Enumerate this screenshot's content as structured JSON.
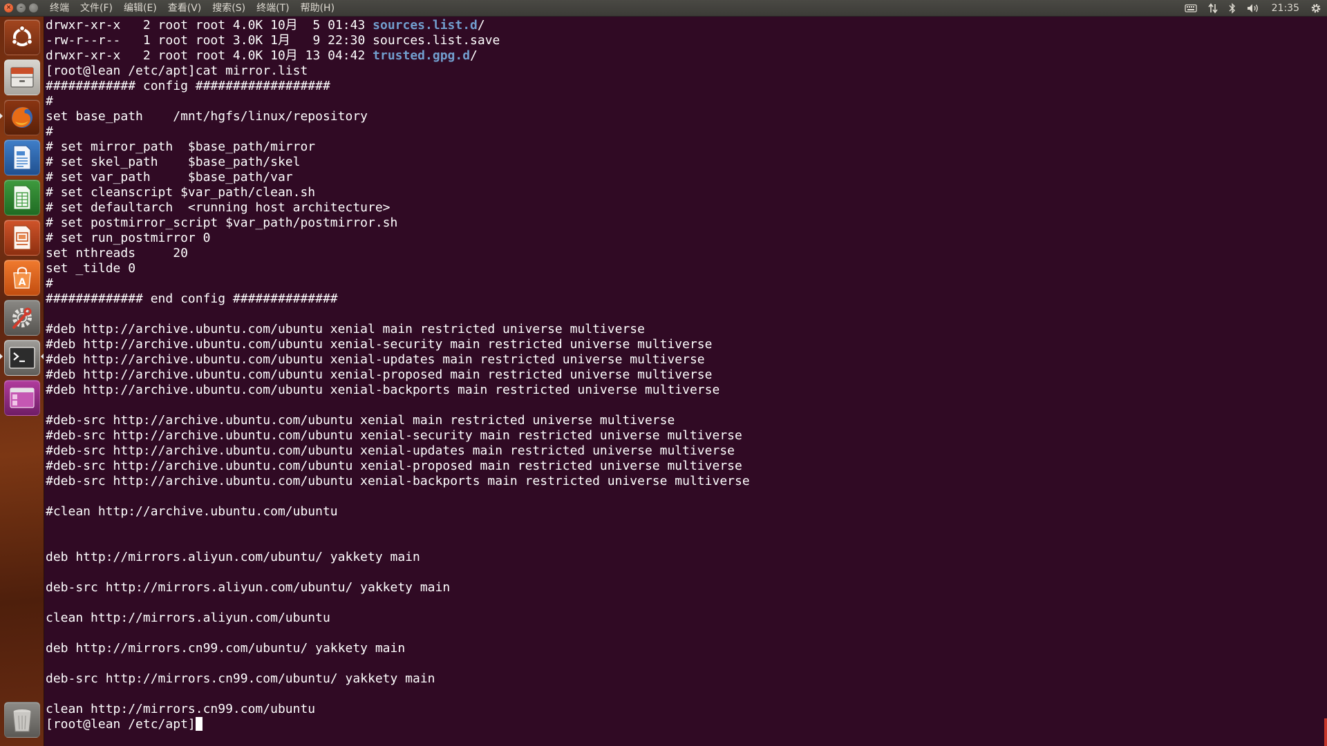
{
  "window": {
    "buttons": [
      {
        "name": "close-button",
        "glyph": "×"
      },
      {
        "name": "minimize-button",
        "glyph": "–"
      },
      {
        "name": "maximize-button",
        "glyph": ""
      }
    ]
  },
  "menubar": {
    "items": [
      "终端",
      "文件(F)",
      "编辑(E)",
      "查看(V)",
      "搜索(S)",
      "终端(T)",
      "帮助(H)"
    ]
  },
  "indicators": {
    "keyboard_icon": "keyboard-icon",
    "network_icon": "network-icon",
    "bluetooth_icon": "bluetooth-icon",
    "sound_icon": "volume-icon",
    "clock": "21:35",
    "settings_icon": "gear-icon"
  },
  "launcher": {
    "items": [
      {
        "name": "dash-home",
        "icon": "ubuntu-logo-icon"
      },
      {
        "name": "files",
        "icon": "file-cabinet-icon"
      },
      {
        "name": "firefox",
        "icon": "firefox-icon"
      },
      {
        "name": "writer",
        "icon": "document-icon"
      },
      {
        "name": "calc",
        "icon": "spreadsheet-icon"
      },
      {
        "name": "impress",
        "icon": "presentation-icon"
      },
      {
        "name": "software-center",
        "icon": "shopping-bag-icon"
      },
      {
        "name": "system-settings",
        "icon": "wrench-gear-icon"
      },
      {
        "name": "terminal",
        "icon": "terminal-icon"
      },
      {
        "name": "workspace-switcher",
        "icon": "workspaces-icon"
      },
      {
        "name": "trash",
        "icon": "trash-icon"
      }
    ]
  },
  "colors": {
    "terminal_bg": "#300a24",
    "terminal_fg": "#ffffff",
    "directory": "#729fcf"
  },
  "terminal": {
    "lines": [
      {
        "text": "drwxr-xr-x   2 root root 4.0K 10月  5 01:43 ",
        "dir": "sources.list.d",
        "suffix": "/"
      },
      {
        "text": "-rw-r--r--   1 root root 3.0K 1月   9 22:30 sources.list.save"
      },
      {
        "text": "drwxr-xr-x   2 root root 4.0K 10月 13 04:42 ",
        "dir": "trusted.gpg.d",
        "suffix": "/"
      },
      {
        "text": "[root@lean /etc/apt]cat mirror.list"
      },
      {
        "text": "############ config ##################"
      },
      {
        "text": "#"
      },
      {
        "text": "set base_path    /mnt/hgfs/linux/repository"
      },
      {
        "text": "#"
      },
      {
        "text": "# set mirror_path  $base_path/mirror"
      },
      {
        "text": "# set skel_path    $base_path/skel"
      },
      {
        "text": "# set var_path     $base_path/var"
      },
      {
        "text": "# set cleanscript $var_path/clean.sh"
      },
      {
        "text": "# set defaultarch  <running host architecture>"
      },
      {
        "text": "# set postmirror_script $var_path/postmirror.sh"
      },
      {
        "text": "# set run_postmirror 0"
      },
      {
        "text": "set nthreads     20"
      },
      {
        "text": "set _tilde 0"
      },
      {
        "text": "#"
      },
      {
        "text": "############# end config ##############"
      },
      {
        "text": ""
      },
      {
        "text": "#deb http://archive.ubuntu.com/ubuntu xenial main restricted universe multiverse"
      },
      {
        "text": "#deb http://archive.ubuntu.com/ubuntu xenial-security main restricted universe multiverse"
      },
      {
        "text": "#deb http://archive.ubuntu.com/ubuntu xenial-updates main restricted universe multiverse"
      },
      {
        "text": "#deb http://archive.ubuntu.com/ubuntu xenial-proposed main restricted universe multiverse"
      },
      {
        "text": "#deb http://archive.ubuntu.com/ubuntu xenial-backports main restricted universe multiverse"
      },
      {
        "text": ""
      },
      {
        "text": "#deb-src http://archive.ubuntu.com/ubuntu xenial main restricted universe multiverse"
      },
      {
        "text": "#deb-src http://archive.ubuntu.com/ubuntu xenial-security main restricted universe multiverse"
      },
      {
        "text": "#deb-src http://archive.ubuntu.com/ubuntu xenial-updates main restricted universe multiverse"
      },
      {
        "text": "#deb-src http://archive.ubuntu.com/ubuntu xenial-proposed main restricted universe multiverse"
      },
      {
        "text": "#deb-src http://archive.ubuntu.com/ubuntu xenial-backports main restricted universe multiverse"
      },
      {
        "text": ""
      },
      {
        "text": "#clean http://archive.ubuntu.com/ubuntu"
      },
      {
        "text": ""
      },
      {
        "text": ""
      },
      {
        "text": "deb http://mirrors.aliyun.com/ubuntu/ yakkety main"
      },
      {
        "text": ""
      },
      {
        "text": "deb-src http://mirrors.aliyun.com/ubuntu/ yakkety main"
      },
      {
        "text": ""
      },
      {
        "text": "clean http://mirrors.aliyun.com/ubuntu"
      },
      {
        "text": ""
      },
      {
        "text": "deb http://mirrors.cn99.com/ubuntu/ yakkety main"
      },
      {
        "text": ""
      },
      {
        "text": "deb-src http://mirrors.cn99.com/ubuntu/ yakkety main"
      },
      {
        "text": ""
      },
      {
        "text": "clean http://mirrors.cn99.com/ubuntu"
      }
    ],
    "prompt": "[root@lean /etc/apt]"
  }
}
